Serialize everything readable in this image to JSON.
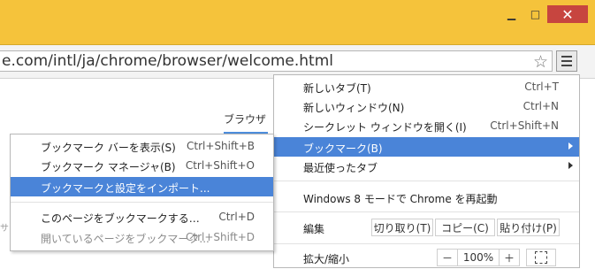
{
  "window": {
    "minimize_symbol": "▁",
    "maximize_symbol": "□",
    "close_symbol": "✕"
  },
  "toolbar": {
    "url": "e.com/intl/ja/chrome/browser/welcome.html",
    "star_symbol": "☆"
  },
  "page": {
    "browser_label": "ブラウザ",
    "edge_text": "サ"
  },
  "menu": {
    "items": [
      {
        "label": "新しいタブ(T)",
        "shortcut": "Ctrl+T"
      },
      {
        "label": "新しいウィンドウ(N)",
        "shortcut": "Ctrl+N"
      },
      {
        "label": "シークレット ウィンドウを開く(I)",
        "shortcut": "Ctrl+Shift+N"
      },
      {
        "label": "ブックマーク(B)",
        "shortcut": ""
      },
      {
        "label": "最近使ったタブ",
        "shortcut": ""
      },
      {
        "label": "Windows 8 モードで Chrome を再起動",
        "shortcut": ""
      }
    ],
    "edit": {
      "label": "編集",
      "cut": "切り取り(T)",
      "copy": "コピー(C)",
      "paste": "貼り付け(P)"
    },
    "zoom": {
      "label": "拡大/縮小",
      "minus": "－",
      "value": "100%",
      "plus": "＋"
    }
  },
  "submenu": {
    "items": [
      {
        "label": "ブックマーク バーを表示(S)",
        "shortcut": "Ctrl+Shift+B"
      },
      {
        "label": "ブックマーク マネージャ(B)",
        "shortcut": "Ctrl+Shift+O"
      },
      {
        "label": "ブックマークと設定をインポート...",
        "shortcut": ""
      },
      {
        "label": "このページをブックマークする…",
        "shortcut": "Ctrl+D"
      },
      {
        "label": "開いているページをブックマーク...",
        "shortcut": "Ctrl+Shift+D"
      }
    ]
  },
  "colors": {
    "frame": "#f5c33b",
    "highlight": "#4a84d8",
    "close_button": "#c7453f"
  }
}
